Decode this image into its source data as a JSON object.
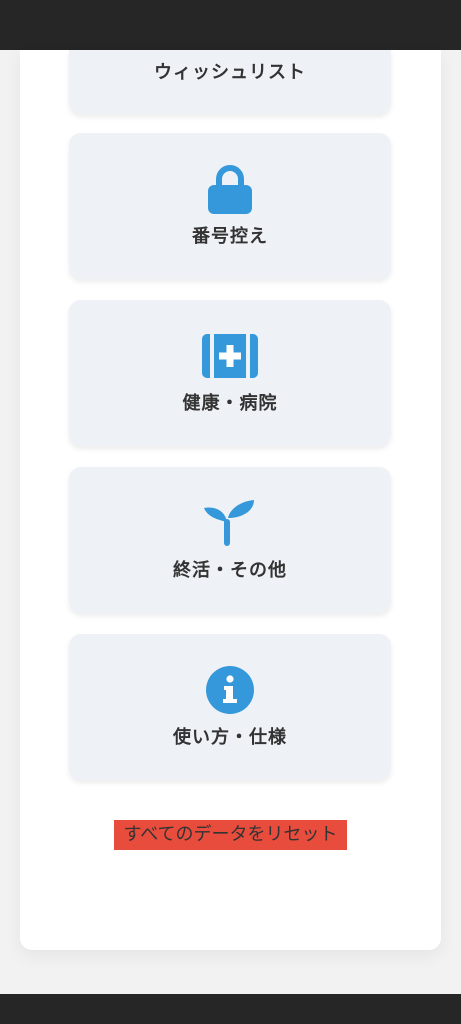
{
  "colors": {
    "accent": "#3498db",
    "tile_background": "#eef2f7",
    "danger": "#e74c3c",
    "text": "#333333"
  },
  "menu": {
    "items": [
      {
        "label": "ウィッシュリスト",
        "icon": "list-icon"
      },
      {
        "label": "番号控え",
        "icon": "lock-icon"
      },
      {
        "label": "健康・病院",
        "icon": "medical-kit-icon"
      },
      {
        "label": "終活・その他",
        "icon": "seedling-icon"
      },
      {
        "label": "使い方・仕様",
        "icon": "info-icon"
      }
    ]
  },
  "reset": {
    "label": "すべてのデータをリセット"
  }
}
